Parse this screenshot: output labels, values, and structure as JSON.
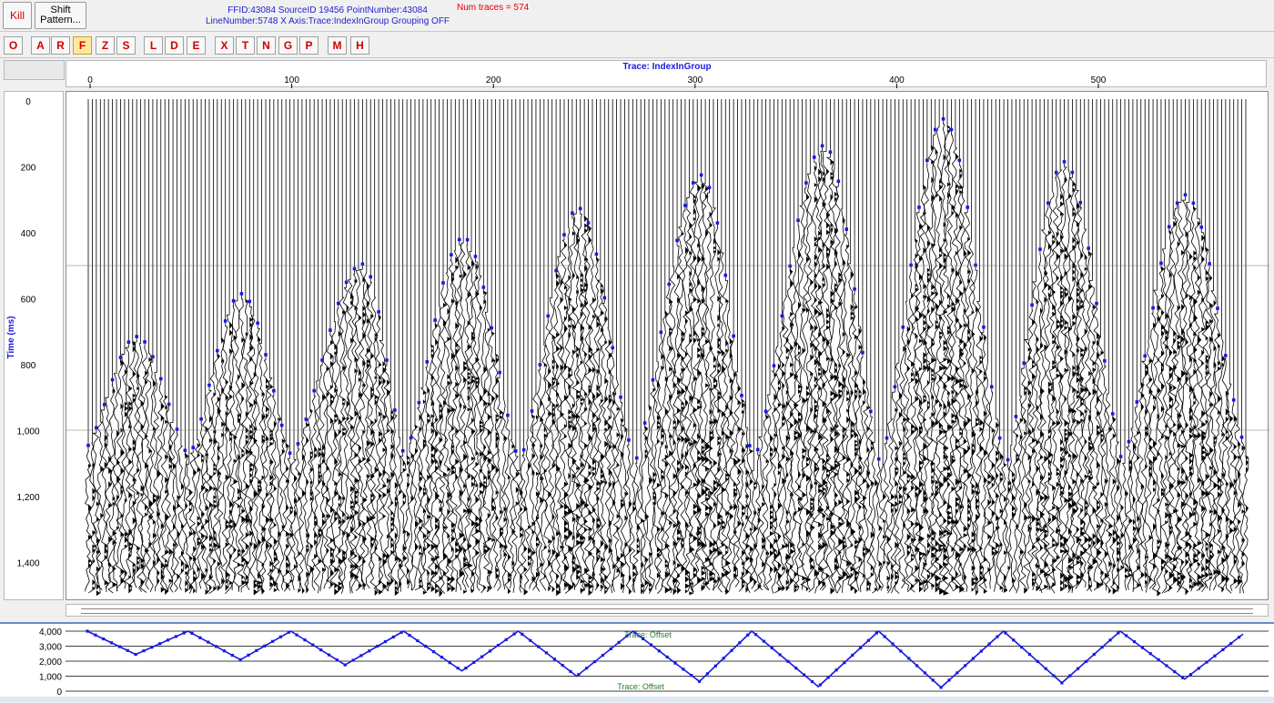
{
  "header": {
    "kill_label": "Kill",
    "shift_label": "Shift\nPattern...",
    "info_line1": "FFID:43084 SourceID 19456 PointNumber:43084",
    "info_line2": "LineNumber:5748  X Axis:Trace:IndexInGroup Grouping OFF",
    "num_traces": "Num traces = 574"
  },
  "toolbar": {
    "buttons": [
      {
        "label": "O",
        "active": false
      },
      {
        "label": "A",
        "active": false
      },
      {
        "label": "R",
        "active": false
      },
      {
        "label": "F",
        "active": true
      },
      {
        "label": "Z",
        "active": false
      },
      {
        "label": "S",
        "active": false
      },
      {
        "label": "L",
        "active": false
      },
      {
        "label": "D",
        "active": false
      },
      {
        "label": "E",
        "active": false
      },
      {
        "label": "X",
        "active": false
      },
      {
        "label": "T",
        "active": false
      },
      {
        "label": "N",
        "active": false
      },
      {
        "label": "G",
        "active": false
      },
      {
        "label": "P",
        "active": false
      },
      {
        "label": "M",
        "active": false
      },
      {
        "label": "H",
        "active": false
      }
    ]
  },
  "colors": {
    "pick": "#1a1ae0",
    "trace": "#000000",
    "axis_title": "#1a1ae0",
    "offset_label": "#2a7a2a",
    "grid": "#000000"
  },
  "chart_data": [
    {
      "type": "scatter",
      "title": "",
      "xlabel": "Trace: IndexInGroup",
      "ylabel": "Time (ms)",
      "xlim": [
        0,
        574
      ],
      "ylim": [
        1500,
        0
      ],
      "x_ticks": [
        "0",
        "100",
        "200",
        "300",
        "400",
        "500"
      ],
      "y_ticks": [
        "0",
        "200",
        "400",
        "600",
        "800",
        "1,000",
        "1,200",
        "1,400"
      ],
      "grid": false,
      "apex_picks": [
        {
          "trace": 24,
          "time_ms": 720
        },
        {
          "trace": 76,
          "time_ms": 590
        },
        {
          "trace": 136,
          "time_ms": 500
        },
        {
          "trace": 186,
          "time_ms": 420
        },
        {
          "trace": 243,
          "time_ms": 330
        },
        {
          "trace": 304,
          "time_ms": 230
        },
        {
          "trace": 365,
          "time_ms": 140
        },
        {
          "trace": 424,
          "time_ms": 60
        },
        {
          "trace": 484,
          "time_ms": 190
        },
        {
          "trace": 544,
          "time_ms": 290
        }
      ],
      "trough_picks": [
        {
          "trace": 0,
          "time_ms": 1050
        },
        {
          "trace": 50,
          "time_ms": 1090
        },
        {
          "trace": 101,
          "time_ms": 1090
        },
        {
          "trace": 157,
          "time_ms": 1090
        },
        {
          "trace": 214,
          "time_ms": 1110
        },
        {
          "trace": 271,
          "time_ms": 1110
        },
        {
          "trace": 330,
          "time_ms": 1110
        },
        {
          "trace": 393,
          "time_ms": 1120
        },
        {
          "trace": 455,
          "time_ms": 1120
        },
        {
          "trace": 513,
          "time_ms": 1110
        },
        {
          "trace": 574,
          "time_ms": 1070
        }
      ]
    },
    {
      "type": "line",
      "title": "Trace: Offset",
      "xlabel": "Trace: Offset",
      "ylabel": "",
      "xlim": [
        0,
        574
      ],
      "ylim": [
        0,
        4000
      ],
      "y_ticks": [
        "4,000",
        "3,000",
        "2,000",
        "1,000",
        "0"
      ],
      "grid": true,
      "series": [
        {
          "x": [
            0,
            24,
            50,
            76,
            101,
            128,
            157,
            186,
            214,
            243,
            271,
            304,
            330,
            363,
            393,
            424,
            455,
            484,
            513,
            545,
            574
          ],
          "y": [
            4000,
            2450,
            4000,
            2100,
            4000,
            1750,
            4000,
            1350,
            4000,
            1000,
            4000,
            650,
            4000,
            300,
            4000,
            250,
            4000,
            550,
            4000,
            800,
            3800
          ]
        }
      ]
    }
  ]
}
